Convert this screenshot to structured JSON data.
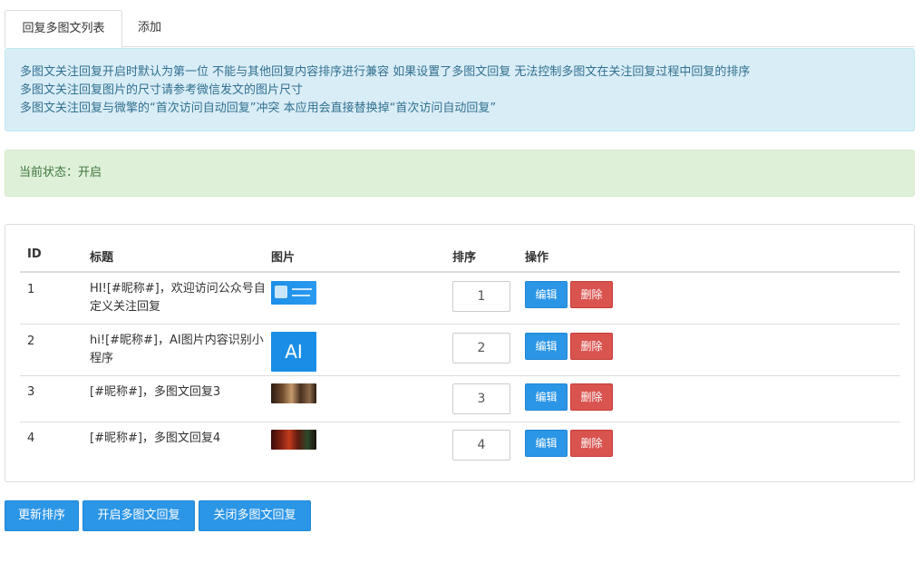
{
  "tabs": [
    {
      "label": "回复多图文列表",
      "active": true
    },
    {
      "label": "添加",
      "active": false
    }
  ],
  "info": {
    "lines": [
      "多图文关注回复开启时默认为第一位 不能与其他回复内容排序进行兼容 如果设置了多图文回复 无法控制多图文在关注回复过程中回复的排序",
      "多图文关注回复图片的尺寸请参考微信发文的图片尺寸",
      "多图文关注回复与微擎的“首次访问自动回复”冲突 本应用会直接替换掉“首次访问自动回复”"
    ]
  },
  "status": {
    "text": "当前状态：开启"
  },
  "table": {
    "headers": {
      "id": "ID",
      "title": "标题",
      "image": "图片",
      "sort": "排序",
      "actions": "操作"
    },
    "rows": [
      {
        "id": "1",
        "title": "HI![#昵称#]，欢迎访问公众号自定义关注回复",
        "image": "blue-banner-thumbnail",
        "sort": "1",
        "edit": "编辑",
        "delete": "删除"
      },
      {
        "id": "2",
        "title": "hi![#昵称#]，AI图片内容识别小程序",
        "image_text": "AI",
        "sort": "2",
        "edit": "编辑",
        "delete": "删除"
      },
      {
        "id": "3",
        "title": "[#昵称#]，多图文回复3",
        "image": "photo-thumbnail",
        "sort": "3",
        "edit": "编辑",
        "delete": "删除"
      },
      {
        "id": "4",
        "title": "[#昵称#]，多图文回复4",
        "image": "photo-thumbnail",
        "sort": "4",
        "edit": "编辑",
        "delete": "删除"
      }
    ]
  },
  "buttons": {
    "update_sort": "更新排序",
    "enable": "开启多图文回复",
    "disable": "关闭多图文回复"
  },
  "colors": {
    "primary": "#2b95e6",
    "danger": "#d9534f",
    "info_bg": "#d9edf7",
    "success_bg": "#dff0d8"
  }
}
